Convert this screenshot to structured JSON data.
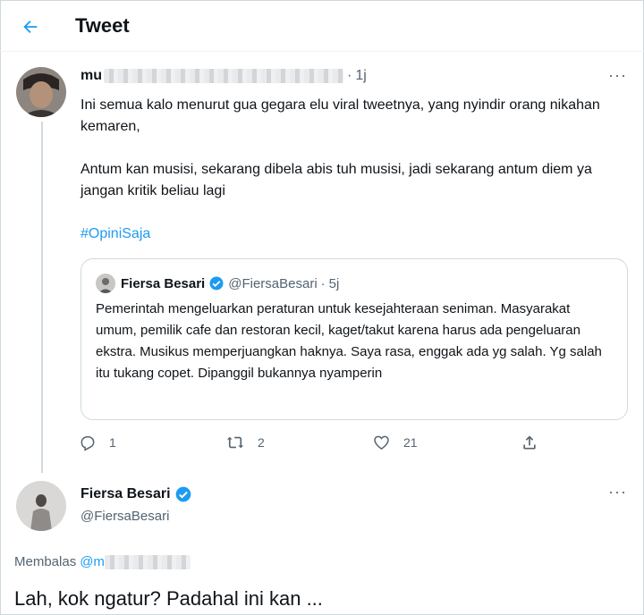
{
  "header": {
    "title": "Tweet"
  },
  "tweet": {
    "author_name": "mu",
    "time": "1j",
    "paragraphs": [
      "Ini semua kalo menurut gua gegara elu viral tweetnya, yang nyindir orang nikahan kemaren,",
      "Antum kan musisi, sekarang dibela abis tuh musisi, jadi sekarang antum diem ya jangan kritik beliau lagi"
    ],
    "hashtag": "#OpiniSaja",
    "quote": {
      "name": "Fiersa Besari",
      "handle": "@FiersaBesari",
      "time": "5j",
      "text": "Pemerintah mengeluarkan peraturan untuk kesejahteraan seniman. Masyarakat umum, pemilik cafe dan restoran kecil, kaget/takut karena harus ada pengeluaran ekstra. Musikus memperjuangkan haknya. Saya rasa, enggak ada yg salah. Yg salah itu tukang copet. Dipanggil bukannya nyamperin"
    },
    "actions": {
      "replies": "1",
      "retweets": "2",
      "likes": "21"
    }
  },
  "reply": {
    "name": "Fiersa Besari",
    "handle": "@FiersaBesari",
    "replying_label": "Membalas",
    "replying_to": "@m",
    "text": "Lah, kok ngatur? Padahal ini kan ..."
  },
  "icons": {
    "back": "arrow-left-icon",
    "more": "more-horizontal-icon",
    "verified": "verified-badge-icon",
    "reply": "reply-icon",
    "retweet": "retweet-icon",
    "like": "heart-icon",
    "share": "share-icon"
  },
  "colors": {
    "accent": "#1d9bf0",
    "secondary_text": "#536471",
    "border": "#cfd9de"
  }
}
